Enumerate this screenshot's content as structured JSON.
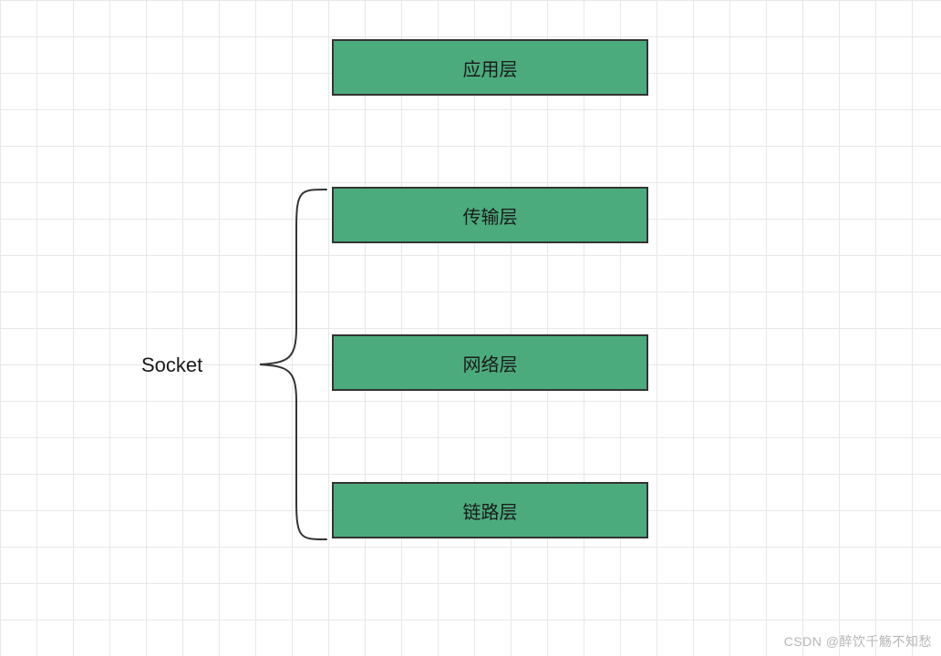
{
  "diagram": {
    "title": "Socket",
    "layers": {
      "application": "应用层",
      "transport": "传输层",
      "network": "网络层",
      "link": "链路层"
    }
  },
  "watermark": "CSDN @醉饮千觞不知愁"
}
